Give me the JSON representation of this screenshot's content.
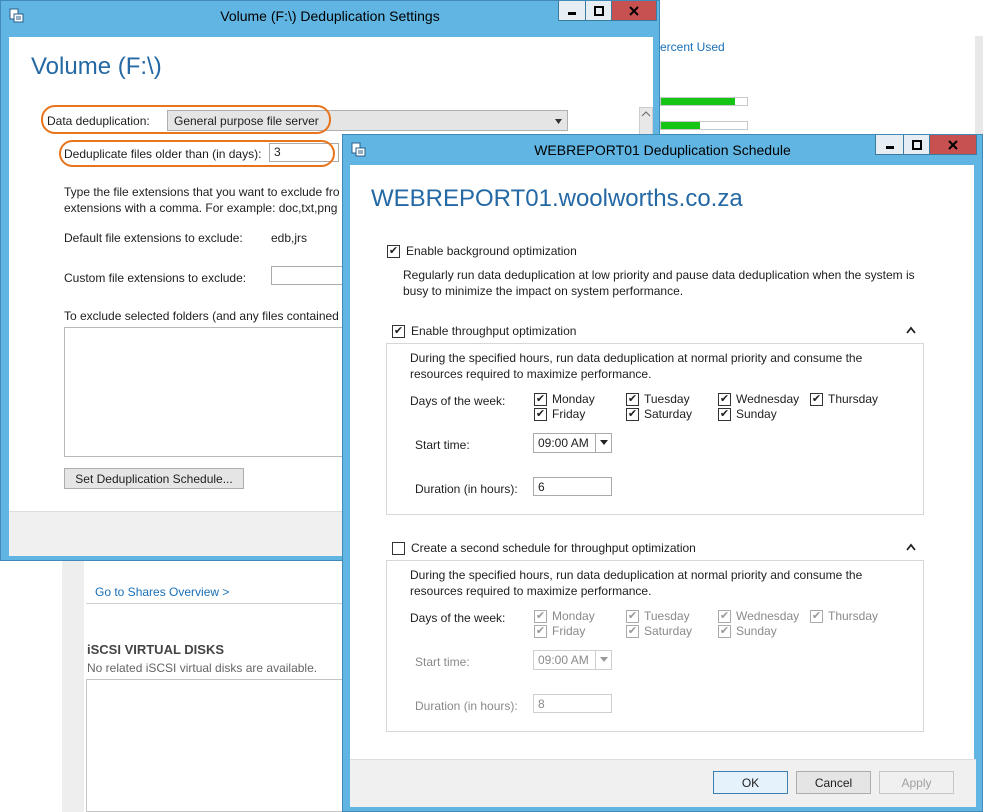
{
  "background": {
    "column_header": "ercent Used",
    "usage_bars": [
      0.86,
      0.45
    ],
    "shares_link": "Go to Shares Overview >",
    "iscsi_title": "iSCSI VIRTUAL DISKS",
    "iscsi_text": "No related iSCSI virtual disks are available."
  },
  "volume_dialog": {
    "title": "Volume (F:\\) Deduplication Settings",
    "heading": "Volume (F:\\)",
    "dedup_label": "Data deduplication:",
    "dedup_value": "General purpose file server",
    "older_label": "Deduplicate files older than (in days):",
    "older_value": "3",
    "ext_help": "Type the file extensions that you want to exclude fro",
    "ext_help_2": "extensions with a comma. For example: doc,txt,png",
    "default_ext_label": "Default file extensions to exclude:",
    "default_ext_value": "edb,jrs",
    "custom_ext_label": "Custom file extensions to exclude:",
    "folders_text": "To exclude selected folders (and any files contained i",
    "schedule_button": "Set Deduplication Schedule..."
  },
  "schedule_dialog": {
    "title": "WEBREPORT01 Deduplication Schedule",
    "heading": "WEBREPORT01.woolworths.co.za",
    "bg_opt_label": "Enable background optimization",
    "bg_opt_checked": true,
    "bg_opt_desc_1": "Regularly run data deduplication at low priority and pause data deduplication when the system is",
    "bg_opt_desc_2": "busy to minimize the impact on system performance.",
    "schedule1": {
      "label": "Enable throughput optimization",
      "checked": true,
      "desc_1": "During the specified hours, run data deduplication at normal priority and consume the",
      "desc_2": "resources required to maximize performance.",
      "days_label": "Days of the week:",
      "days": [
        {
          "name": "Monday",
          "checked": true
        },
        {
          "name": "Tuesday",
          "checked": true
        },
        {
          "name": "Wednesday",
          "checked": true
        },
        {
          "name": "Thursday",
          "checked": true
        },
        {
          "name": "Friday",
          "checked": true
        },
        {
          "name": "Saturday",
          "checked": true
        },
        {
          "name": "Sunday",
          "checked": true
        }
      ],
      "start_label": "Start time:",
      "start_value": "09:00 AM",
      "duration_label": "Duration (in hours):",
      "duration_value": "6"
    },
    "schedule2": {
      "label": "Create a second schedule for throughput optimization",
      "checked": false,
      "desc_1": "During the specified hours, run data deduplication at normal priority and consume the",
      "desc_2": "resources required to maximize performance.",
      "days_label": "Days of the week:",
      "days": [
        {
          "name": "Monday",
          "checked": true
        },
        {
          "name": "Tuesday",
          "checked": true
        },
        {
          "name": "Wednesday",
          "checked": true
        },
        {
          "name": "Thursday",
          "checked": true
        },
        {
          "name": "Friday",
          "checked": true
        },
        {
          "name": "Saturday",
          "checked": true
        },
        {
          "name": "Sunday",
          "checked": true
        }
      ],
      "start_label": "Start time:",
      "start_value": "09:00 AM",
      "duration_label": "Duration (in hours):",
      "duration_value": "8"
    },
    "ok": "OK",
    "cancel": "Cancel",
    "apply": "Apply"
  },
  "icons": {
    "minimize": "minimize-icon",
    "maximize": "maximize-icon",
    "close": "close-icon",
    "app": "dedup-app-icon",
    "chevron": "chevron-up-icon",
    "dropdown": "dropdown-arrow-icon"
  },
  "colors": {
    "titlebar": "#60b5e3",
    "heading": "#2468a4",
    "highlight": "#e8741b",
    "usage_green": "#16c416",
    "close_red": "#c75050"
  }
}
